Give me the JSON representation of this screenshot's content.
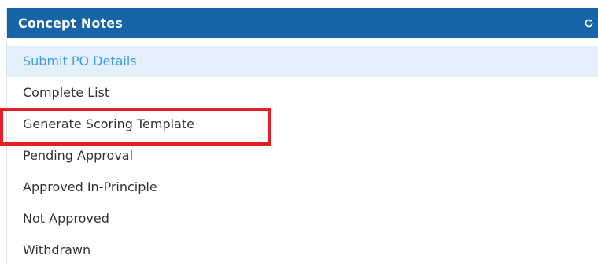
{
  "panel": {
    "title": "Concept Notes",
    "refresh_icon": "refresh-icon",
    "header_color": "#1565a8"
  },
  "menu": {
    "items": [
      {
        "label": "Submit PO Details",
        "active": true
      },
      {
        "label": "Complete List",
        "active": false
      },
      {
        "label": "Generate Scoring Template",
        "active": false,
        "highlighted": true
      },
      {
        "label": "Pending Approval",
        "active": false
      },
      {
        "label": "Approved In-Principle",
        "active": false
      },
      {
        "label": "Not Approved",
        "active": false
      },
      {
        "label": "Withdrawn",
        "active": false
      }
    ]
  },
  "colors": {
    "active_bg": "#e4f1fc",
    "active_text": "#3d9be9",
    "highlight_border": "#e31e24"
  }
}
